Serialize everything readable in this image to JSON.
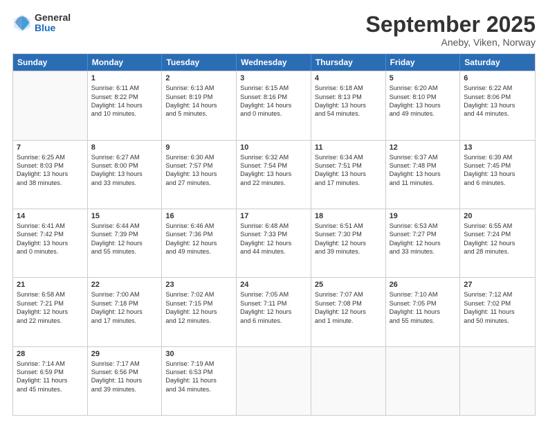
{
  "header": {
    "logo": {
      "general": "General",
      "blue": "Blue"
    },
    "title": "September 2025",
    "location": "Aneby, Viken, Norway"
  },
  "weekdays": [
    "Sunday",
    "Monday",
    "Tuesday",
    "Wednesday",
    "Thursday",
    "Friday",
    "Saturday"
  ],
  "weeks": [
    [
      {
        "day": "",
        "lines": []
      },
      {
        "day": "1",
        "lines": [
          "Sunrise: 6:11 AM",
          "Sunset: 8:22 PM",
          "Daylight: 14 hours",
          "and 10 minutes."
        ]
      },
      {
        "day": "2",
        "lines": [
          "Sunrise: 6:13 AM",
          "Sunset: 8:19 PM",
          "Daylight: 14 hours",
          "and 5 minutes."
        ]
      },
      {
        "day": "3",
        "lines": [
          "Sunrise: 6:15 AM",
          "Sunset: 8:16 PM",
          "Daylight: 14 hours",
          "and 0 minutes."
        ]
      },
      {
        "day": "4",
        "lines": [
          "Sunrise: 6:18 AM",
          "Sunset: 8:13 PM",
          "Daylight: 13 hours",
          "and 54 minutes."
        ]
      },
      {
        "day": "5",
        "lines": [
          "Sunrise: 6:20 AM",
          "Sunset: 8:10 PM",
          "Daylight: 13 hours",
          "and 49 minutes."
        ]
      },
      {
        "day": "6",
        "lines": [
          "Sunrise: 6:22 AM",
          "Sunset: 8:06 PM",
          "Daylight: 13 hours",
          "and 44 minutes."
        ]
      }
    ],
    [
      {
        "day": "7",
        "lines": [
          "Sunrise: 6:25 AM",
          "Sunset: 8:03 PM",
          "Daylight: 13 hours",
          "and 38 minutes."
        ]
      },
      {
        "day": "8",
        "lines": [
          "Sunrise: 6:27 AM",
          "Sunset: 8:00 PM",
          "Daylight: 13 hours",
          "and 33 minutes."
        ]
      },
      {
        "day": "9",
        "lines": [
          "Sunrise: 6:30 AM",
          "Sunset: 7:57 PM",
          "Daylight: 13 hours",
          "and 27 minutes."
        ]
      },
      {
        "day": "10",
        "lines": [
          "Sunrise: 6:32 AM",
          "Sunset: 7:54 PM",
          "Daylight: 13 hours",
          "and 22 minutes."
        ]
      },
      {
        "day": "11",
        "lines": [
          "Sunrise: 6:34 AM",
          "Sunset: 7:51 PM",
          "Daylight: 13 hours",
          "and 17 minutes."
        ]
      },
      {
        "day": "12",
        "lines": [
          "Sunrise: 6:37 AM",
          "Sunset: 7:48 PM",
          "Daylight: 13 hours",
          "and 11 minutes."
        ]
      },
      {
        "day": "13",
        "lines": [
          "Sunrise: 6:39 AM",
          "Sunset: 7:45 PM",
          "Daylight: 13 hours",
          "and 6 minutes."
        ]
      }
    ],
    [
      {
        "day": "14",
        "lines": [
          "Sunrise: 6:41 AM",
          "Sunset: 7:42 PM",
          "Daylight: 13 hours",
          "and 0 minutes."
        ]
      },
      {
        "day": "15",
        "lines": [
          "Sunrise: 6:44 AM",
          "Sunset: 7:39 PM",
          "Daylight: 12 hours",
          "and 55 minutes."
        ]
      },
      {
        "day": "16",
        "lines": [
          "Sunrise: 6:46 AM",
          "Sunset: 7:36 PM",
          "Daylight: 12 hours",
          "and 49 minutes."
        ]
      },
      {
        "day": "17",
        "lines": [
          "Sunrise: 6:48 AM",
          "Sunset: 7:33 PM",
          "Daylight: 12 hours",
          "and 44 minutes."
        ]
      },
      {
        "day": "18",
        "lines": [
          "Sunrise: 6:51 AM",
          "Sunset: 7:30 PM",
          "Daylight: 12 hours",
          "and 39 minutes."
        ]
      },
      {
        "day": "19",
        "lines": [
          "Sunrise: 6:53 AM",
          "Sunset: 7:27 PM",
          "Daylight: 12 hours",
          "and 33 minutes."
        ]
      },
      {
        "day": "20",
        "lines": [
          "Sunrise: 6:55 AM",
          "Sunset: 7:24 PM",
          "Daylight: 12 hours",
          "and 28 minutes."
        ]
      }
    ],
    [
      {
        "day": "21",
        "lines": [
          "Sunrise: 6:58 AM",
          "Sunset: 7:21 PM",
          "Daylight: 12 hours",
          "and 22 minutes."
        ]
      },
      {
        "day": "22",
        "lines": [
          "Sunrise: 7:00 AM",
          "Sunset: 7:18 PM",
          "Daylight: 12 hours",
          "and 17 minutes."
        ]
      },
      {
        "day": "23",
        "lines": [
          "Sunrise: 7:02 AM",
          "Sunset: 7:15 PM",
          "Daylight: 12 hours",
          "and 12 minutes."
        ]
      },
      {
        "day": "24",
        "lines": [
          "Sunrise: 7:05 AM",
          "Sunset: 7:11 PM",
          "Daylight: 12 hours",
          "and 6 minutes."
        ]
      },
      {
        "day": "25",
        "lines": [
          "Sunrise: 7:07 AM",
          "Sunset: 7:08 PM",
          "Daylight: 12 hours",
          "and 1 minute."
        ]
      },
      {
        "day": "26",
        "lines": [
          "Sunrise: 7:10 AM",
          "Sunset: 7:05 PM",
          "Daylight: 11 hours",
          "and 55 minutes."
        ]
      },
      {
        "day": "27",
        "lines": [
          "Sunrise: 7:12 AM",
          "Sunset: 7:02 PM",
          "Daylight: 11 hours",
          "and 50 minutes."
        ]
      }
    ],
    [
      {
        "day": "28",
        "lines": [
          "Sunrise: 7:14 AM",
          "Sunset: 6:59 PM",
          "Daylight: 11 hours",
          "and 45 minutes."
        ]
      },
      {
        "day": "29",
        "lines": [
          "Sunrise: 7:17 AM",
          "Sunset: 6:56 PM",
          "Daylight: 11 hours",
          "and 39 minutes."
        ]
      },
      {
        "day": "30",
        "lines": [
          "Sunrise: 7:19 AM",
          "Sunset: 6:53 PM",
          "Daylight: 11 hours",
          "and 34 minutes."
        ]
      },
      {
        "day": "",
        "lines": []
      },
      {
        "day": "",
        "lines": []
      },
      {
        "day": "",
        "lines": []
      },
      {
        "day": "",
        "lines": []
      }
    ]
  ]
}
